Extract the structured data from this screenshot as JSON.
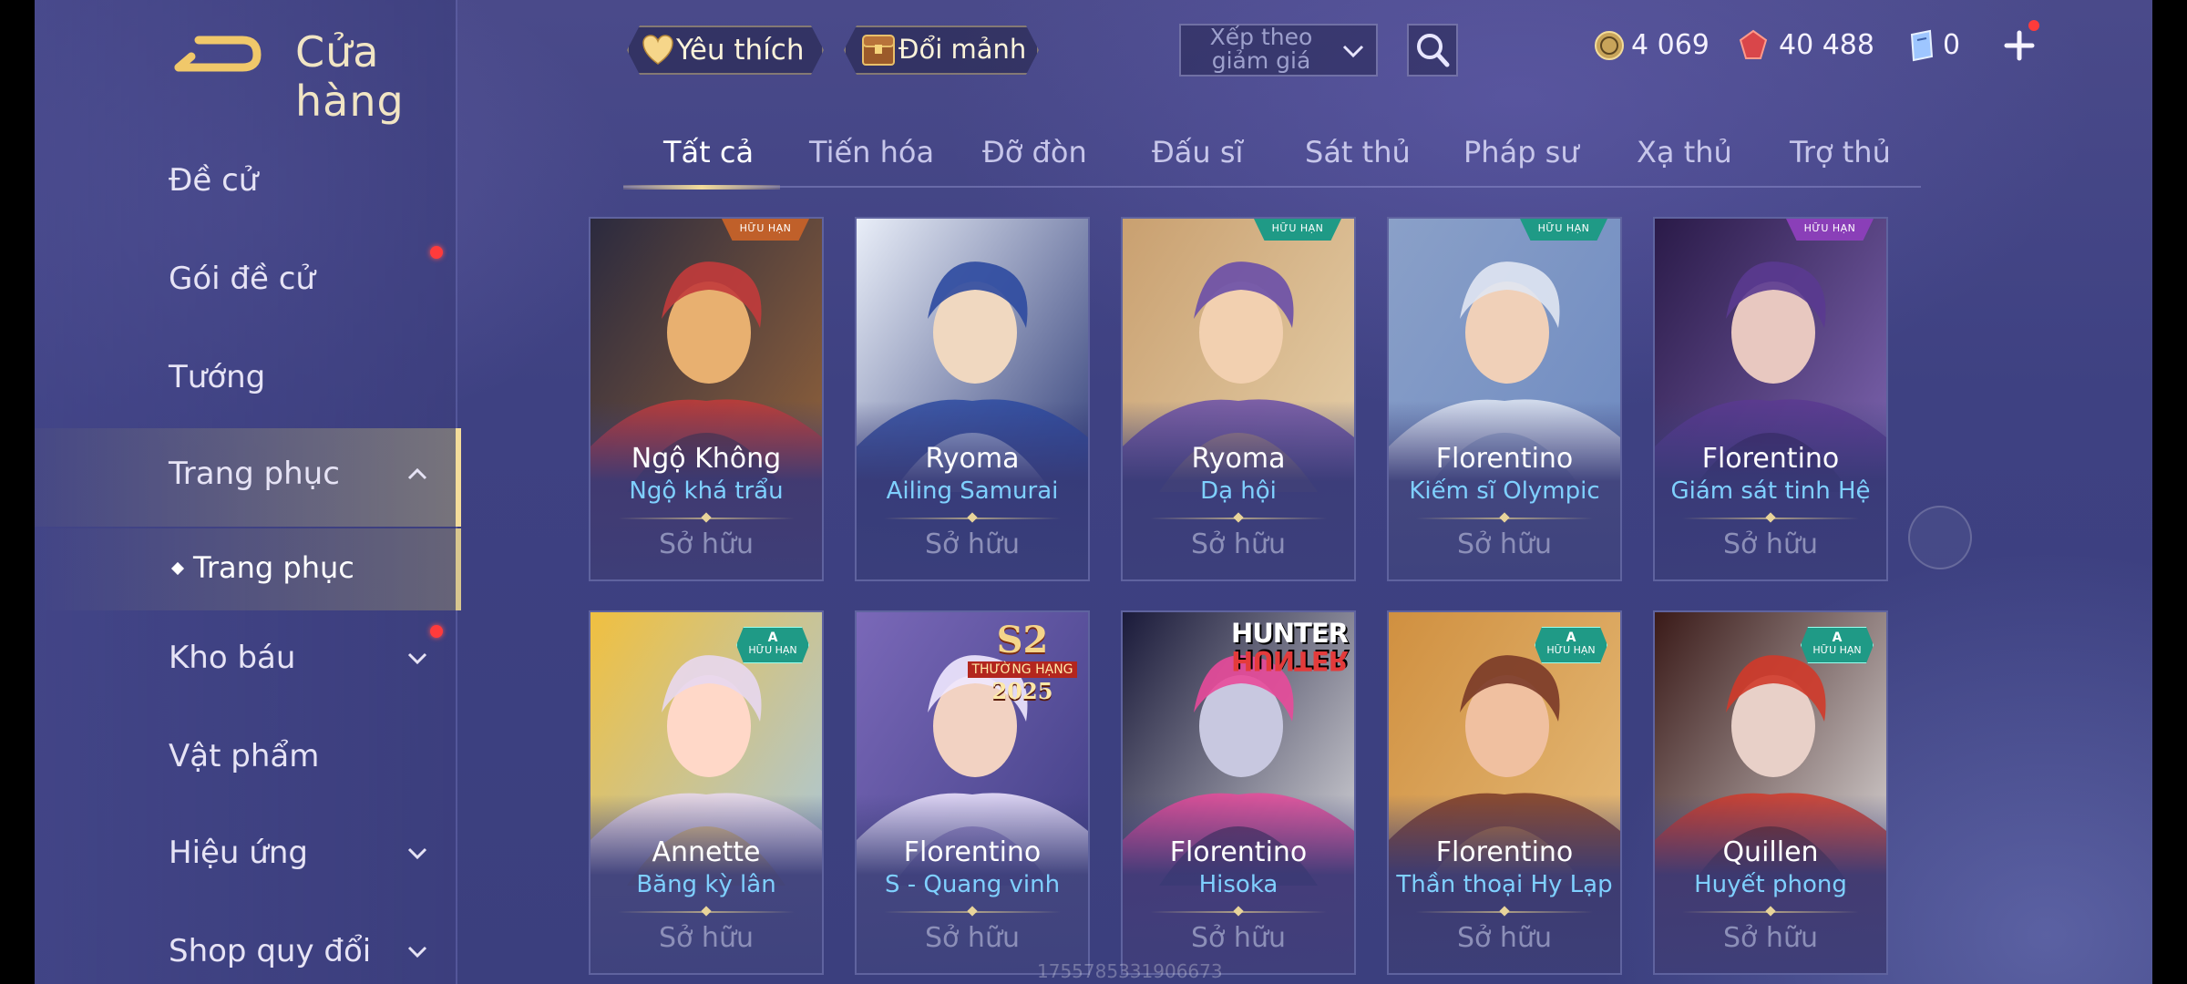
{
  "header": {
    "title": "Cửa hàng",
    "favorites_label": "Yêu thích",
    "exchange_label": "Đổi mảnh",
    "sort_label": "Xếp theo giảm giá"
  },
  "currencies": [
    {
      "name": "gold-coin",
      "value": "4 069"
    },
    {
      "name": "red-voucher",
      "value": "40 488"
    },
    {
      "name": "blue-ticket",
      "value": "0"
    }
  ],
  "sidebar": {
    "items": [
      {
        "label": "Đề cử",
        "dot": false,
        "chevron": ""
      },
      {
        "label": "Gói đề cử",
        "dot": true,
        "chevron": ""
      },
      {
        "label": "Tướng",
        "dot": false,
        "chevron": ""
      },
      {
        "label": "Trang phục",
        "dot": false,
        "chevron": "up"
      },
      {
        "label": "Kho báu",
        "dot": true,
        "chevron": "down"
      },
      {
        "label": "Vật phẩm",
        "dot": false,
        "chevron": ""
      },
      {
        "label": "Hiệu ứng",
        "dot": false,
        "chevron": "down"
      },
      {
        "label": "Shop quy đổi",
        "dot": false,
        "chevron": "down"
      }
    ],
    "sub_item": "Trang phục"
  },
  "tabs": [
    "Tất cả",
    "Tiến hóa",
    "Đỡ đòn",
    "Đấu sĩ",
    "Sát thủ",
    "Pháp sư",
    "Xạ thủ",
    "Trợ thủ"
  ],
  "cards": [
    {
      "hero": "Ngộ Không",
      "skin": "Ngộ khá trẩu",
      "status": "Sở hữu",
      "badge": "HỮU HẠN",
      "badge_color": "#c0602a"
    },
    {
      "hero": "Ryoma",
      "skin": "Ailing Samurai",
      "status": "Sở hữu",
      "badge": "",
      "badge_color": ""
    },
    {
      "hero": "Ryoma",
      "skin": "Dạ hội",
      "status": "Sở hữu",
      "badge": "HỮU HẠN",
      "badge_color": "#1f9a86"
    },
    {
      "hero": "Florentino",
      "skin": "Kiếm sĩ Olympic",
      "status": "Sở hữu",
      "badge": "HỮU HẠN",
      "badge_color": "#1f9a86"
    },
    {
      "hero": "Florentino",
      "skin": "Giám sát tinh Hệ",
      "status": "Sở hữu",
      "badge": "HỮU HẠN",
      "badge_color": "#8a3fb8"
    },
    {
      "hero": "Annette",
      "skin": "Băng kỳ lân",
      "status": "Sở hữu",
      "badge": "HỮU HẠN",
      "badge_color": "#1f9a86"
    },
    {
      "hero": "Florentino",
      "skin": "S - Quang vinh",
      "status": "Sở hữu",
      "badge": "",
      "badge_color": ""
    },
    {
      "hero": "Florentino",
      "skin": "Hisoka",
      "status": "Sở hữu",
      "badge": "",
      "badge_color": ""
    },
    {
      "hero": "Florentino",
      "skin": "Thần thoại Hy Lạp",
      "status": "Sở hữu",
      "badge": "HỮU HẠN",
      "badge_color": "#1f9a86"
    },
    {
      "hero": "Quillen",
      "skin": "Huyết phong",
      "status": "Sở hữu",
      "badge": "HỮU HẠN",
      "badge_color": "#1f9a86"
    }
  ],
  "logos": {
    "s2_title": "S2",
    "s2_rank": "THƯỜNG HẠNG",
    "s2_year": "2025",
    "hunter_top": "HUNTER",
    "hunter_bottom": "HUNTER",
    "badge_grade": "A"
  },
  "watermark": "1755785331906673"
}
